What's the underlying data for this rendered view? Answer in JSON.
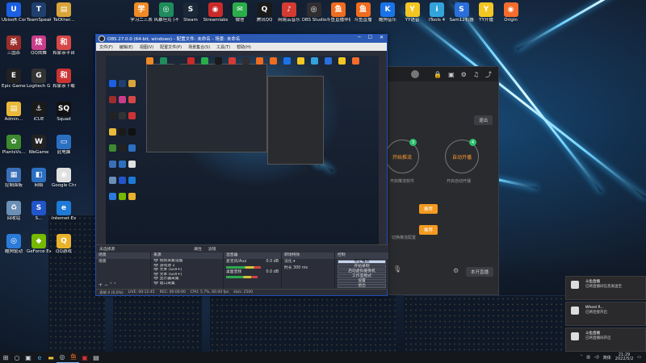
{
  "desktop": {
    "icons_left": [
      {
        "label": "Ubisoft Connect",
        "color": "#1b5fe3",
        "glyph": "U"
      },
      {
        "label": "TeamSpeak",
        "color": "#1f3f6e",
        "glyph": "T"
      },
      {
        "label": "TeOther...",
        "color": "#d9a43a",
        "glyph": "▤"
      },
      {
        "label": "三国杀",
        "color": "#9b2e2a",
        "glyph": "杀"
      },
      {
        "label": "QQ炫舞",
        "color": "#c93d8a",
        "glyph": "炫"
      },
      {
        "label": "和家亲平台",
        "color": "#d64848",
        "glyph": "和"
      },
      {
        "label": "Epic Games Launcher",
        "color": "#222222",
        "glyph": "E"
      },
      {
        "label": "Logitech G HUB",
        "color": "#333333",
        "glyph": "G"
      },
      {
        "label": "和家亲下载",
        "color": "#cc3333",
        "glyph": "和"
      },
      {
        "label": "Admin...",
        "color": "#e8b93a",
        "glyph": "▤"
      },
      {
        "label": "iCUE",
        "color": "#1a1a1a",
        "glyph": "⚓"
      },
      {
        "label": "Squad",
        "color": "#111111",
        "glyph": "SQ"
      },
      {
        "label": "PlantsVs...",
        "color": "#3d8a2f",
        "glyph": "✿"
      },
      {
        "label": "WeGame",
        "color": "#222222",
        "glyph": "W"
      },
      {
        "label": "此电脑",
        "color": "#2b6fc2",
        "glyph": "▭"
      },
      {
        "label": "控制面板",
        "color": "#3a6fb8",
        "glyph": "▦"
      },
      {
        "label": "网络",
        "color": "#2b6fc2",
        "glyph": "◧"
      },
      {
        "label": "Google Chrome",
        "color": "#e0e0e0",
        "glyph": "◉"
      },
      {
        "label": "回收站",
        "color": "#6b8fb5",
        "glyph": "♻"
      },
      {
        "label": "S...",
        "color": "#2255cc",
        "glyph": "S"
      },
      {
        "label": "Internet Explorer",
        "color": "#1e7ad6",
        "glyph": "e"
      },
      {
        "label": "酷狗驱动",
        "color": "#2a7bd9",
        "glyph": "◎"
      },
      {
        "label": "GeForce Experience",
        "color": "#76b900",
        "glyph": "◆"
      },
      {
        "label": "QQ游戏",
        "color": "#e8b22b",
        "glyph": "Q"
      }
    ],
    "icons_top": [
      {
        "label": "学习二三表",
        "color": "#f08a24",
        "glyph": "学"
      },
      {
        "label": "风暴坦克 (不用)",
        "color": "#1f8c5c",
        "glyph": "◎"
      },
      {
        "label": "Steam",
        "color": "#1b2838",
        "glyph": "S"
      },
      {
        "label": "Streamlabs OBS",
        "color": "#c92a2a",
        "glyph": "◉"
      },
      {
        "label": "微信",
        "color": "#2bad4a",
        "glyph": "✉"
      },
      {
        "label": "腾讯QQ",
        "color": "#1a1a1a",
        "glyph": "Q"
      },
      {
        "label": "网易云音乐",
        "color": "#d33b33",
        "glyph": "♪"
      },
      {
        "label": "OBS Studio",
        "color": "#302e31",
        "glyph": "◎"
      },
      {
        "label": "斗鱼直播伴侣",
        "color": "#f06c1e",
        "glyph": "鱼"
      },
      {
        "label": "斗鱼直播",
        "color": "#f06c1e",
        "glyph": "鱼"
      },
      {
        "label": "酷狗音乐",
        "color": "#1a73e8",
        "glyph": "K"
      },
      {
        "label": "YY语音",
        "color": "#f3c623",
        "glyph": "Y"
      },
      {
        "label": "iTools 4",
        "color": "#33a3dc",
        "glyph": "i"
      },
      {
        "label": "Sam12机器",
        "color": "#2a6fdb",
        "glyph": "S"
      },
      {
        "label": "YY开播",
        "color": "#f3c623",
        "glyph": "Y"
      },
      {
        "label": "Origin",
        "color": "#f56c2d",
        "glyph": "◉"
      }
    ]
  },
  "obs": {
    "title": "OBS 27.0.0 (64-bit, windows) - 配置文件: 未命名 - 场景: 未命名",
    "menu": [
      "文件(F)",
      "编辑(E)",
      "视图(V)",
      "配置文件(P)",
      "场景集合(S)",
      "工具(T)",
      "帮助(H)"
    ],
    "source_bar_label": "未选择源",
    "properties_label": "属性",
    "filters_label": "滤镜",
    "docks": {
      "scenes_title": "场景",
      "scenes": [
        "场景"
      ],
      "sources_title": "来源",
      "sources": [
        "视频采集设备",
        "游戏源 2",
        "文本 (GDI+)",
        "文本 (GDI+)",
        "显示器采集",
        "窗口采集"
      ],
      "mixer_title": "混音器",
      "mixer": [
        {
          "name": "麦克风/Aux",
          "db": "0.0 dB",
          "level": 0.55
        },
        {
          "name": "桌面音频",
          "db": "0.0 dB",
          "level": 0.5
        }
      ],
      "transitions_title": "转场特效",
      "transition_type": "淡化",
      "transition_duration_label": "时长",
      "transition_duration": "300 ms",
      "controls_title": "控制",
      "controls": [
        "停止推流",
        "开始录制",
        "启动虚拟摄像机",
        "工作室模式",
        "设置",
        "退出"
      ]
    },
    "status": {
      "dropped": "丢帧 0 (0.0%)",
      "live": "LIVE: 00:12:45",
      "rec": "REC: 00:00:00",
      "cpu": "CPU: 5.7%, 60.00 fps",
      "kbps": "kb/s: 2500"
    }
  },
  "stream_app": {
    "button_left": "开始推流",
    "button_right": "自动开播",
    "badge_left": "3",
    "badge_right": "4",
    "chip_out": "退出",
    "pill1": "推荐",
    "pill2": "推荐",
    "bottom_btn": "本开直播",
    "tip": "切换推流配置"
  },
  "notifications": [
    {
      "title": "斗鱼直播",
      "body": "已将直播间信息发送至"
    },
    {
      "title": "Wheel R...",
      "body": "已将连接开启"
    },
    {
      "title": "斗鱼直播",
      "body": "已将直播间开启"
    }
  ],
  "taskbar": {
    "time": "21:29",
    "date": "2022/5/2",
    "ime": "简体",
    "items": [
      "start",
      "search",
      "task-view",
      "edge",
      "explorer",
      "obs",
      "douyu",
      "xiaohongshu",
      "notes"
    ]
  }
}
